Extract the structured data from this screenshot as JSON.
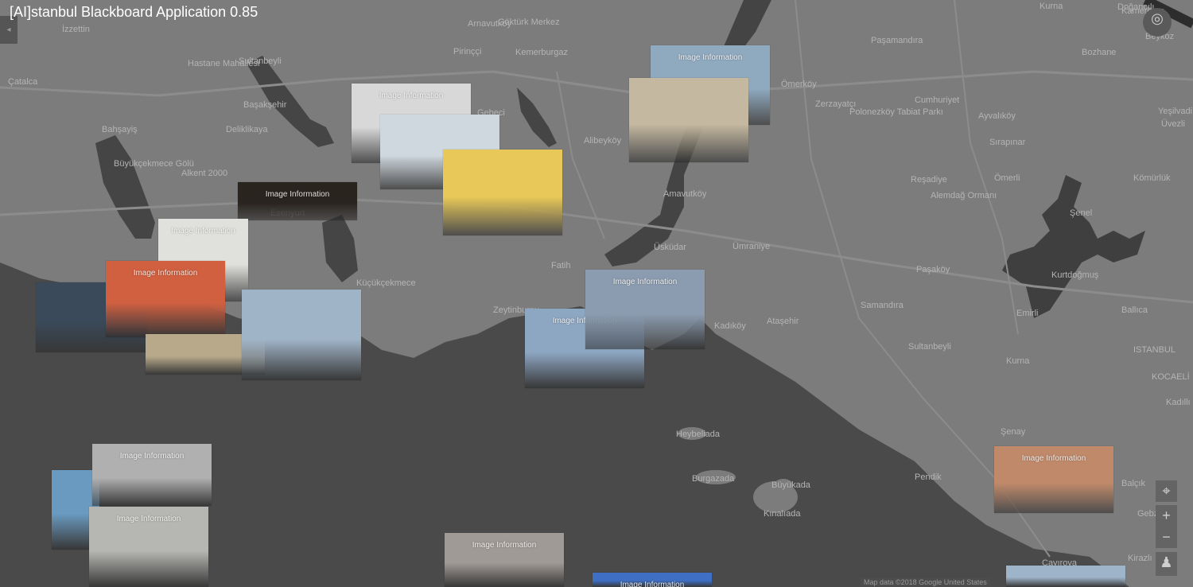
{
  "app": {
    "title": "[AI]stanbul Blackboard Application 0.85"
  },
  "map_labels": [
    {
      "text": "İzzettin"
    },
    {
      "text": "Arnavutköy"
    },
    {
      "text": "Göktürk Merkez"
    },
    {
      "text": "Kemerburgaz"
    },
    {
      "text": "Pirinççi"
    },
    {
      "text": "Paşamandıra"
    },
    {
      "text": "Doğancılı"
    },
    {
      "text": "Kurna"
    },
    {
      "text": "Çatalca"
    },
    {
      "text": "Hastane Mahallesi"
    },
    {
      "text": "Sultanbeyli"
    },
    {
      "text": "Başakşehir"
    },
    {
      "text": "Bahşayiş"
    },
    {
      "text": "Deliklikaya"
    },
    {
      "text": "Alkent 2000"
    },
    {
      "text": "Büyükçekmece Gölü"
    },
    {
      "text": "Esenyurt"
    },
    {
      "text": "Gebeci"
    },
    {
      "text": "Alibeyköy"
    },
    {
      "text": "Amavutköy"
    },
    {
      "text": "Ümraniye"
    },
    {
      "text": "Üsküdar"
    },
    {
      "text": "Fatih"
    },
    {
      "text": "Zeytinburnu"
    },
    {
      "text": "Küçükçekmece"
    },
    {
      "text": "Kadıköy"
    },
    {
      "text": "Ataşehir"
    },
    {
      "text": "Samandıra"
    },
    {
      "text": "Sultanbeyli"
    },
    {
      "text": "Pendik"
    },
    {
      "text": "Çayırova"
    },
    {
      "text": "Ömerköy"
    },
    {
      "text": "Zerzayatçı"
    },
    {
      "text": "Polonezköy Tabiat Parkı"
    },
    {
      "text": "Cumhuriyet"
    },
    {
      "text": "Ayvalıköy"
    },
    {
      "text": "Sırapınar"
    },
    {
      "text": "Reşadiye"
    },
    {
      "text": "Alemdağ Ormanı"
    },
    {
      "text": "Kömürlük"
    },
    {
      "text": "Ömerli"
    },
    {
      "text": "Kurtdoğmuş"
    },
    {
      "text": "Ballıca"
    },
    {
      "text": "Emirli"
    },
    {
      "text": "Paşaköy"
    },
    {
      "text": "Bozhane"
    },
    {
      "text": "Yeşilvadi"
    },
    {
      "text": "Üvezli"
    },
    {
      "text": "Beykoz"
    },
    {
      "text": "Kamerdere"
    },
    {
      "text": "Şenel"
    },
    {
      "text": "Şenay"
    },
    {
      "text": "Kurna"
    },
    {
      "text": "Heybeliada"
    },
    {
      "text": "Burgazada"
    },
    {
      "text": "Kınalıada"
    },
    {
      "text": "Büyükada"
    },
    {
      "text": "ISTANBUL"
    },
    {
      "text": "KOCAELİ"
    },
    {
      "text": "Kadıllı"
    },
    {
      "text": "Balçık"
    },
    {
      "text": "Gebze"
    },
    {
      "text": "Kirazlı"
    }
  ],
  "photos": [
    {
      "caption": "Image Information",
      "color": "#d8d8d8"
    },
    {
      "caption": "",
      "color": "#cfd8df"
    },
    {
      "caption": "",
      "color": "#e8c858"
    },
    {
      "caption": "Image Information",
      "color": "#8fa9bf"
    },
    {
      "caption": "",
      "color": "#c4b8a0"
    },
    {
      "caption": "Image Information",
      "color": "#2a241f"
    },
    {
      "caption": "Image Information",
      "color": "#e0e0dc"
    },
    {
      "caption": "",
      "color": "#3a4a5a"
    },
    {
      "caption": "Image Information",
      "color": "#d06040"
    },
    {
      "caption": "",
      "color": "#b7a98a"
    },
    {
      "caption": "",
      "color": "#a0b4c8"
    },
    {
      "caption": "Image Information",
      "color": "#8da6c2"
    },
    {
      "caption": "Image Information",
      "color": "#8c9cb0"
    },
    {
      "caption": "",
      "color": "#6a9ac0"
    },
    {
      "caption": "Image Information",
      "color": "#b0b0b0"
    },
    {
      "caption": "Image Information",
      "color": "#b6b6b2"
    },
    {
      "caption": "Image Information",
      "color": "#a09a96"
    },
    {
      "caption": "Image Information",
      "color": "#3e6fc4"
    },
    {
      "caption": "Image Information",
      "color": "#c08a6a"
    },
    {
      "caption": "",
      "color": "#9eb4c8"
    }
  ],
  "attribution": "Map data ©2018 Google   United States"
}
